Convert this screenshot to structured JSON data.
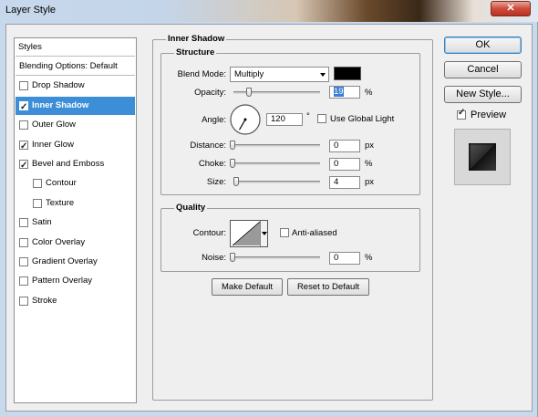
{
  "window": {
    "title": "Layer Style",
    "close_glyph": "✕"
  },
  "styles_panel": {
    "header": "Styles",
    "items": [
      {
        "label": "Blending Options: Default",
        "checkbox": false,
        "checked": false,
        "indent": 0,
        "selected": false
      },
      {
        "label": "Drop Shadow",
        "checkbox": true,
        "checked": false,
        "indent": 0,
        "selected": false
      },
      {
        "label": "Inner Shadow",
        "checkbox": true,
        "checked": true,
        "indent": 0,
        "selected": true
      },
      {
        "label": "Outer Glow",
        "checkbox": true,
        "checked": false,
        "indent": 0,
        "selected": false
      },
      {
        "label": "Inner Glow",
        "checkbox": true,
        "checked": true,
        "indent": 0,
        "selected": false
      },
      {
        "label": "Bevel and Emboss",
        "checkbox": true,
        "checked": true,
        "indent": 0,
        "selected": false
      },
      {
        "label": "Contour",
        "checkbox": true,
        "checked": false,
        "indent": 1,
        "selected": false
      },
      {
        "label": "Texture",
        "checkbox": true,
        "checked": false,
        "indent": 1,
        "selected": false
      },
      {
        "label": "Satin",
        "checkbox": true,
        "checked": false,
        "indent": 0,
        "selected": false
      },
      {
        "label": "Color Overlay",
        "checkbox": true,
        "checked": false,
        "indent": 0,
        "selected": false
      },
      {
        "label": "Gradient Overlay",
        "checkbox": true,
        "checked": false,
        "indent": 0,
        "selected": false
      },
      {
        "label": "Pattern Overlay",
        "checkbox": true,
        "checked": false,
        "indent": 0,
        "selected": false
      },
      {
        "label": "Stroke",
        "checkbox": true,
        "checked": false,
        "indent": 0,
        "selected": false
      }
    ]
  },
  "inner_shadow": {
    "title": "Inner Shadow",
    "structure": {
      "title": "Structure",
      "blend_mode_label": "Blend Mode:",
      "blend_mode_value": "Multiply",
      "color": "#000000",
      "opacity_label": "Opacity:",
      "opacity_value": "19",
      "opacity_unit": "%",
      "opacity_level": 0.19,
      "angle_label": "Angle:",
      "angle_value": "120",
      "angle_unit": "°",
      "angle_degrees": 120,
      "use_global_light_label": "Use Global Light",
      "use_global_light": false,
      "distance_label": "Distance:",
      "distance_value": "0",
      "distance_unit": "px",
      "choke_label": "Choke:",
      "choke_value": "0",
      "choke_unit": "%",
      "size_label": "Size:",
      "size_value": "4",
      "size_unit": "px"
    },
    "quality": {
      "title": "Quality",
      "contour_label": "Contour:",
      "anti_aliased_label": "Anti-aliased",
      "anti_aliased": false,
      "noise_label": "Noise:",
      "noise_value": "0",
      "noise_unit": "%"
    },
    "make_default_label": "Make Default",
    "reset_default_label": "Reset to Default"
  },
  "actions": {
    "ok_label": "OK",
    "cancel_label": "Cancel",
    "new_style_label": "New Style...",
    "preview_label": "Preview",
    "preview_checked": true
  }
}
